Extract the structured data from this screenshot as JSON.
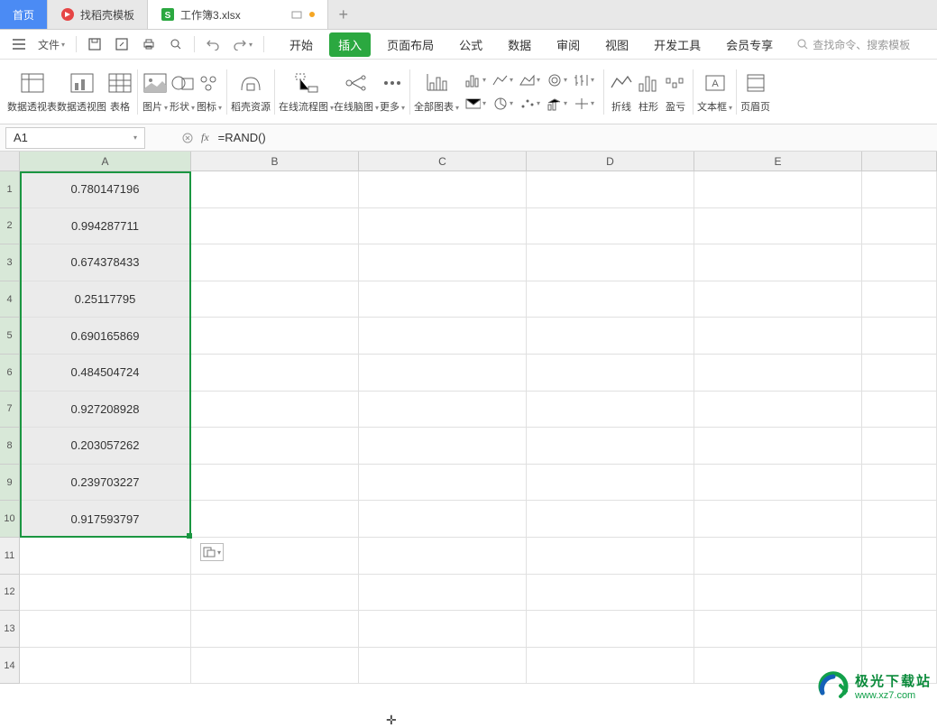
{
  "titlebar": {
    "home_label": "首页",
    "tab1_label": "找稻壳模板",
    "tab2_label": "工作簿3.xlsx"
  },
  "menubar": {
    "file_label": "文件",
    "tabs": [
      "开始",
      "插入",
      "页面布局",
      "公式",
      "数据",
      "审阅",
      "视图",
      "开发工具",
      "会员专享"
    ],
    "active_tab_index": 1,
    "search_placeholder": "查找命令、搜索模板"
  },
  "ribbon": {
    "items": [
      {
        "label": "数据透视表"
      },
      {
        "label": "数据透视图"
      },
      {
        "label": "表格"
      },
      {
        "label": "图片"
      },
      {
        "label": "形状"
      },
      {
        "label": "图标"
      },
      {
        "label": "稻壳资源"
      },
      {
        "label": "在线流程图"
      },
      {
        "label": "在线脑图"
      },
      {
        "label": "更多"
      },
      {
        "label": "全部图表"
      },
      {
        "label": "折线"
      },
      {
        "label": "柱形"
      },
      {
        "label": "盈亏"
      },
      {
        "label": "文本框"
      },
      {
        "label": "页眉页"
      }
    ]
  },
  "formula_bar": {
    "name_box": "A1",
    "formula": "=RAND()"
  },
  "sheet": {
    "columns": [
      "A",
      "B",
      "C",
      "D",
      "E"
    ],
    "selected_values": [
      "0.780147196",
      "0.994287711",
      "0.674378433",
      "0.25117795",
      "0.690165869",
      "0.484504724",
      "0.927208928",
      "0.203057262",
      "0.239703227",
      "0.917593797"
    ],
    "visible_row_count": 14
  },
  "watermark": {
    "line1": "极光下载站",
    "line2": "www.xz7.com"
  }
}
